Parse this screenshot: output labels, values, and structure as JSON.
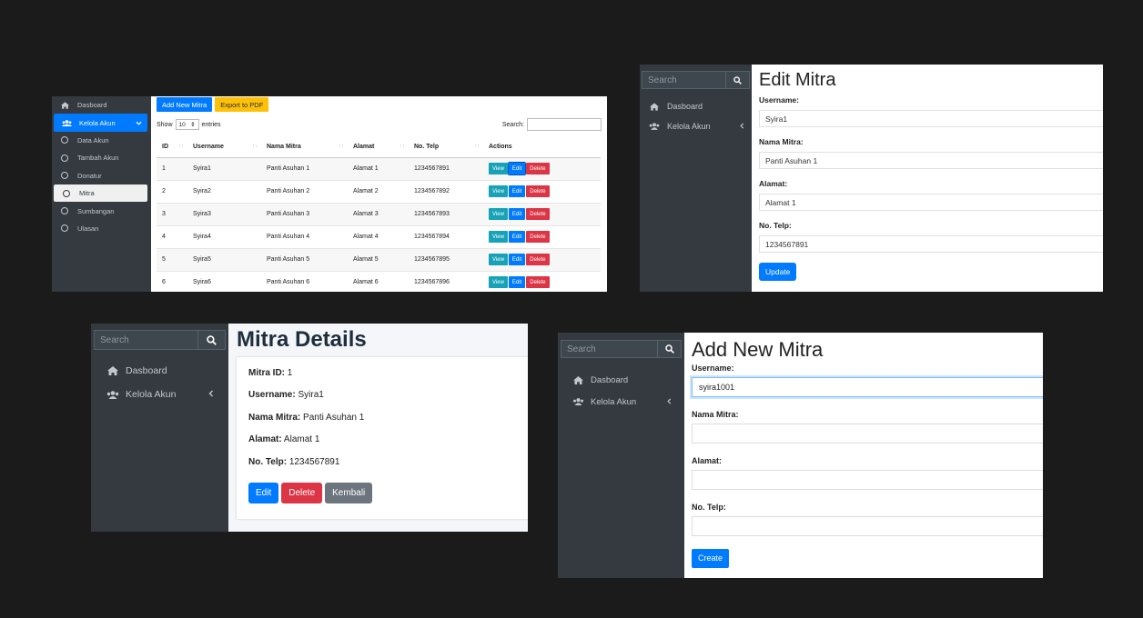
{
  "list_panel": {
    "sidebar": {
      "items": [
        {
          "label": "Dasboard"
        },
        {
          "label": "Kelola Akun"
        },
        {
          "label": "Data Akun"
        },
        {
          "label": "Tambah Akun"
        },
        {
          "label": "Donatur"
        },
        {
          "label": "Mitra"
        },
        {
          "label": "Sumbangan"
        },
        {
          "label": "Ulasan"
        }
      ]
    },
    "toolbar": {
      "add_label": "Add New Mitra",
      "export_label": "Export to PDF"
    },
    "show": {
      "prefix": "Show",
      "value": "10",
      "suffix": "entries"
    },
    "search_label": "Search:",
    "columns": [
      "ID",
      "Username",
      "Nama Mitra",
      "Alamat",
      "No. Telp",
      "Actions"
    ],
    "rows": [
      {
        "id": "1",
        "username": "Syira1",
        "nama": "Panti Asuhan 1",
        "alamat": "Alamat 1",
        "telp": "1234567891"
      },
      {
        "id": "2",
        "username": "Syira2",
        "nama": "Panti Asuhan 2",
        "alamat": "Alamat 2",
        "telp": "1234567892"
      },
      {
        "id": "3",
        "username": "Syira3",
        "nama": "Panti Asuhan 3",
        "alamat": "Alamat 3",
        "telp": "1234567893"
      },
      {
        "id": "4",
        "username": "Syira4",
        "nama": "Panti Asuhan 4",
        "alamat": "Alamat 4",
        "telp": "1234567894"
      },
      {
        "id": "5",
        "username": "Syira5",
        "nama": "Panti Asuhan 5",
        "alamat": "Alamat 5",
        "telp": "1234567895"
      },
      {
        "id": "6",
        "username": "Syira6",
        "nama": "Panti Asuhan 6",
        "alamat": "Alamat 6",
        "telp": "1234567896"
      }
    ],
    "actions": {
      "view": "View",
      "edit": "Edit",
      "delete": "Delete"
    }
  },
  "edit_panel": {
    "search_placeholder": "Search",
    "sidebar": {
      "dashboard": "Dasboard",
      "kelola": "Kelola Akun"
    },
    "title": "Edit Mitra",
    "fields": [
      {
        "label": "Username:",
        "value": "Syira1"
      },
      {
        "label": "Nama Mitra:",
        "value": "Panti Asuhan 1"
      },
      {
        "label": "Alamat:",
        "value": "Alamat 1"
      },
      {
        "label": "No. Telp:",
        "value": "1234567891"
      }
    ],
    "submit_label": "Update"
  },
  "details_panel": {
    "search_placeholder": "Search",
    "sidebar": {
      "dashboard": "Dasboard",
      "kelola": "Kelola Akun"
    },
    "title": "Mitra Details",
    "rows": [
      {
        "label": "Mitra ID:",
        "value": "1"
      },
      {
        "label": "Username:",
        "value": "Syira1"
      },
      {
        "label": "Nama Mitra:",
        "value": "Panti Asuhan 1"
      },
      {
        "label": "Alamat:",
        "value": "Alamat 1"
      },
      {
        "label": "No. Telp:",
        "value": "1234567891"
      }
    ],
    "buttons": {
      "edit": "Edit",
      "delete": "Delete",
      "back": "Kembali"
    }
  },
  "add_panel": {
    "search_placeholder": "Search",
    "sidebar": {
      "dashboard": "Dasboard",
      "kelola": "Kelola Akun"
    },
    "title": "Add New Mitra",
    "fields": [
      {
        "label": "Username:",
        "value": "syira1001"
      },
      {
        "label": "Nama Mitra:",
        "value": ""
      },
      {
        "label": "Alamat:",
        "value": ""
      },
      {
        "label": "No. Telp:",
        "value": ""
      }
    ],
    "submit_label": "Create"
  },
  "colors": {
    "primary": "#007bff",
    "warning": "#ffc107",
    "info": "#17a2b8",
    "danger": "#dc3545",
    "secondary": "#6c757d",
    "sidebar": "#343a40"
  },
  "icons": [
    "home-icon",
    "users-icon",
    "search-icon",
    "chevron-left-icon",
    "chevron-down-icon",
    "circle-icon",
    "sort-icon"
  ]
}
